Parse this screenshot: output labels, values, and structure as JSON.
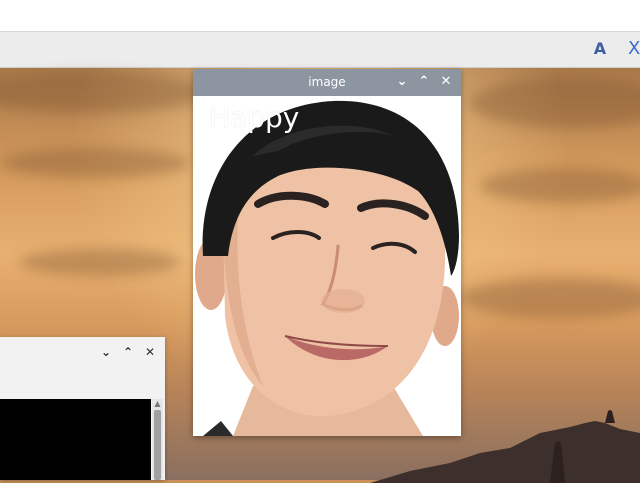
{
  "top_strip": {
    "clipped_text": ""
  },
  "toolbar": {
    "font_button_label": "A",
    "close_button_label": "X"
  },
  "image_window": {
    "title": "image",
    "minimize_glyph": "⌄",
    "maximize_glyph": "⌃",
    "close_glyph": "✕",
    "overlay_label": "Happy"
  },
  "terminal_window": {
    "minimize_glyph": "⌄",
    "maximize_glyph": "⌃",
    "close_glyph": "✕"
  },
  "colors": {
    "titlebar": "#8d95a1",
    "toolbar_accent": "#3f5fa0"
  },
  "icons": [
    "font-icon",
    "close-icon",
    "chevron-down-icon",
    "chevron-up-icon",
    "close-x-icon"
  ]
}
